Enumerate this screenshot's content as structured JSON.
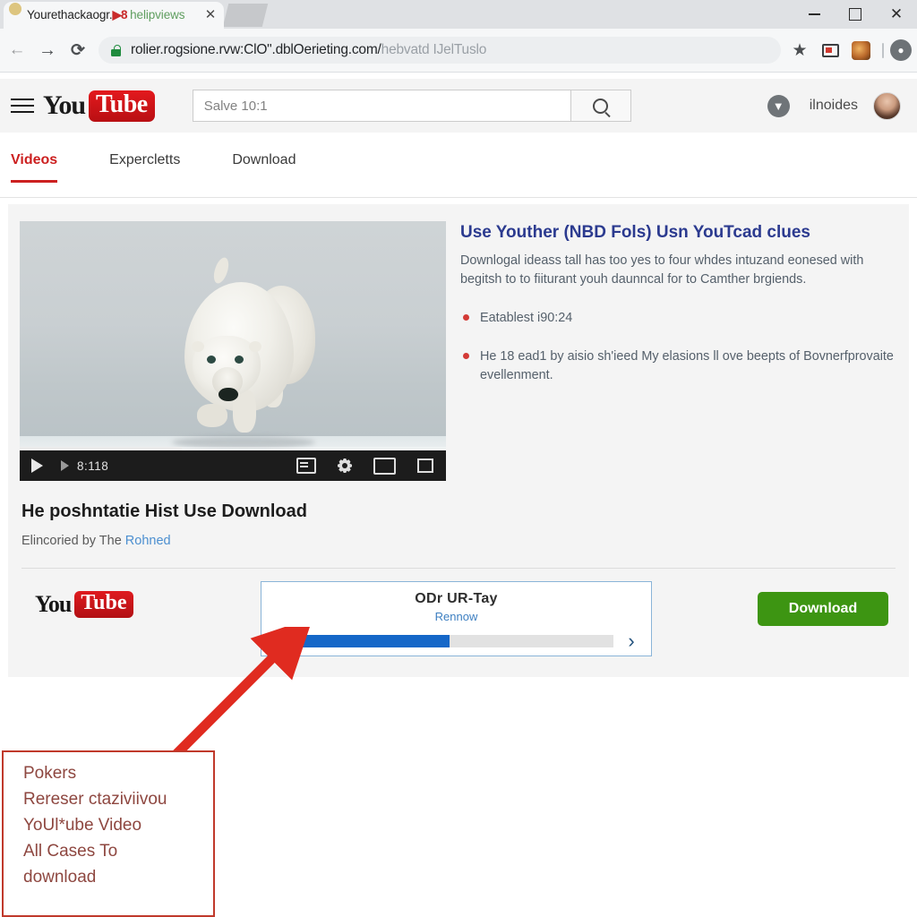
{
  "browser": {
    "tab": {
      "title_main": "Yourethackaogr.",
      "title_red": "▶8",
      "title_green": "helipviews",
      "close_label": "✕"
    },
    "window_controls": {
      "minimize": "—",
      "maximize": "□",
      "close": "✕"
    },
    "nav": {
      "back": "←",
      "forward": "→",
      "reload": "⟳"
    },
    "address": {
      "lock_icon": "lock-icon",
      "url_domain": "rolier.rogsione.rvw:ClO\".dblOerieting.com/",
      "url_path": "hebvatd IJelTuslo"
    },
    "toolbar_icons": {
      "bookmark": "★",
      "cast": "cast-icon",
      "extension": "extension-avatar",
      "profile": "profile-icon"
    }
  },
  "yt_header": {
    "menu_icon": "hamburger-icon",
    "logo_you": "You",
    "logo_tube": "Tube",
    "search_value": "Salve 10:1",
    "search_placeholder": "Salve 10:1",
    "search_button_icon": "search-icon",
    "bird_icon": "▼",
    "username": "ilnoides",
    "avatar": "avatar"
  },
  "tabs": [
    {
      "label": "Videos",
      "active": true
    },
    {
      "label": "Expercletts",
      "active": false
    },
    {
      "label": "Download",
      "active": false
    }
  ],
  "video": {
    "thumbnail_alt": "polar-bear-walking-on-ice",
    "controls": {
      "play_icon": "play-icon",
      "next_icon": "next-icon",
      "time": "8:118",
      "cc_icon": "captions-icon",
      "settings_icon": "gear-icon",
      "theater_icon": "theater-mode-icon",
      "fullscreen_icon": "fullscreen-icon"
    },
    "title": "He poshntatie Hist Use Download",
    "byline_prefix": "Elincoried by The ",
    "byline_link": "Rohned"
  },
  "description": {
    "heading": "Use Youther (NBD Fols) Usn YouTcad clues",
    "paragraph": "Downlogal ideass tall has too yes to four whdes intuzand eonesed with begitsh to to fiiturant youh daunncal for to Camther brgiends.",
    "bullets": [
      "Eatablest i90:24",
      "He 18 ead1 by aisio sh'ieed My elasions ll ove beepts of Bovnerfprovaite evellenment."
    ]
  },
  "downloader": {
    "logo_you": "You",
    "logo_tube": "Tube",
    "progress_title": "ODr UR-Tay",
    "progress_subtitle": "Rennow",
    "prev_icon": "‹",
    "next_icon": "›",
    "progress_percent": 48,
    "download_label": "Download"
  },
  "callout": {
    "lines": [
      "Pokers",
      "Rereser ctaziviivou",
      "YoUl*ube Video",
      "All Cases To",
      "download"
    ],
    "arrow_color": "#e02b20",
    "border_color": "#c0392b"
  },
  "colors": {
    "accent_red": "#cc2020",
    "link_blue": "#4c8fd0",
    "heading_blue": "#2b3a8f",
    "progress_blue": "#1567c8",
    "download_green": "#3d9512"
  }
}
